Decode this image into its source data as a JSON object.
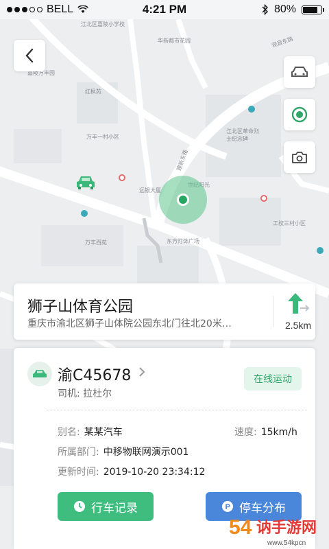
{
  "status_bar": {
    "carrier": "BELL",
    "time": "4:21 PM",
    "battery_text": "80%",
    "battery_level": 0.8
  },
  "map": {
    "labels": [
      "江北区嘉陵小学校",
      "华新都市花园",
      "嘉陵万丰园",
      "红枫苑",
      "万丰一村小区",
      "江北区革命烈士纪念碑",
      "远银大厦",
      "世纪阳光",
      "东方灯饰广场",
      "万丰西苑",
      "工校三村小区",
      "观音东路",
      "建新东路"
    ],
    "icons": {
      "back": "chevron-left-icon",
      "car": "car-icon",
      "locate": "locate-icon",
      "camera": "camera-icon"
    }
  },
  "destination": {
    "title": "狮子山体育公园",
    "address": "重庆市渝北区狮子山体院公园东北门往北20米…",
    "distance": "2.5km"
  },
  "vehicle": {
    "plate": "渝C45678",
    "driver_label": "司机:",
    "driver_name": "拉杜尔",
    "status": "在线运动",
    "alias_label": "别名:",
    "alias": "某某汽车",
    "speed_label": "速度:",
    "speed": "15km/h",
    "dept_label": "所属部门:",
    "dept": "中移物联网演示001",
    "update_label": "更新时间:",
    "update_time": "2019-10-20  23:34:12"
  },
  "actions": {
    "trip_log": "行车记录",
    "parking": "停车分布"
  },
  "watermark": {
    "brand": "54讷手游网",
    "url": "www.54kpcn"
  },
  "colors": {
    "accent_green": "#3fbd7e",
    "accent_blue": "#4a86d9",
    "status_bg": "#e4f5ec"
  }
}
